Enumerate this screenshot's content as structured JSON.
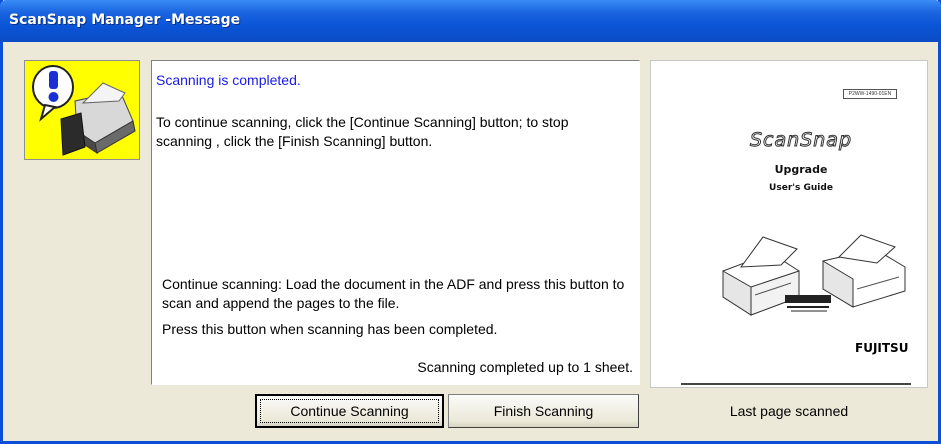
{
  "window": {
    "title": "ScanSnap Manager -Message"
  },
  "message": {
    "status": "Scanning is completed.",
    "instruction": "To continue scanning, click the [Continue Scanning] button; to stop scanning , click the [Finish Scanning] button.",
    "continue_help": "Continue scanning: Load the document in the ADF and press this button to scan and append the pages to the file.",
    "finish_help": "Press this button when scanning has been completed.",
    "count": "Scanning completed up to 1 sheet."
  },
  "buttons": {
    "continue_label": "Continue Scanning",
    "finish_label": "Finish Scanning"
  },
  "preview": {
    "caption": "Last page scanned",
    "doc_tag": "P2WW-1490-01EN",
    "doc_logo": "ScanSnap",
    "doc_title": "Upgrade",
    "doc_subtitle": "User's Guide",
    "doc_brand": "FUJITSU"
  },
  "colors": {
    "titlebar": "#0a4cc4",
    "status_text": "#1a1ae6",
    "icon_background": "#ffff00",
    "window_background": "#ece9d8"
  },
  "icons": {
    "dialog_icon": "scanner-info-icon"
  }
}
